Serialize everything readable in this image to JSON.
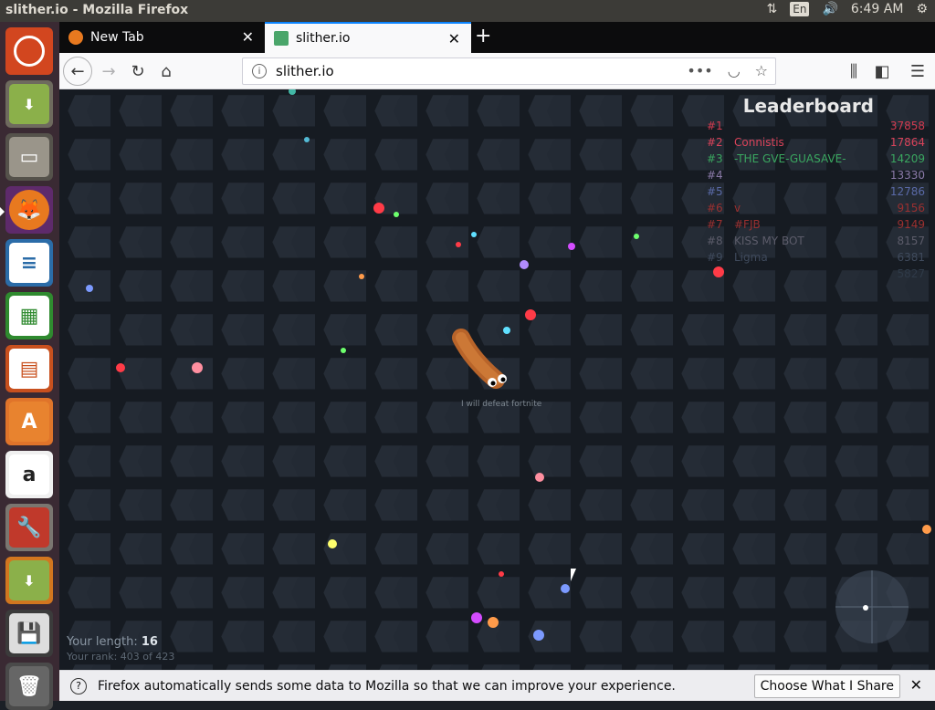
{
  "os_panel": {
    "window_title": "slither.io - Mozilla Firefox",
    "keyboard_layout": "En",
    "clock": "6:49 AM"
  },
  "launcher": {
    "items": [
      "ubuntu-logo",
      "system-installer",
      "file-manager",
      "firefox",
      "libreoffice-writer",
      "libreoffice-calc",
      "libreoffice-impress",
      "ubuntu-software",
      "amazon",
      "system-settings",
      "system-installer-2",
      "floppy-save",
      "trash"
    ]
  },
  "browser": {
    "tabs": [
      {
        "label": "New Tab",
        "active": false
      },
      {
        "label": "slither.io",
        "active": true
      }
    ],
    "url": "slither.io",
    "notification": {
      "message": "Firefox automatically sends some data to Mozilla so that we can improve your experience.",
      "button_label": "Choose What I Share"
    }
  },
  "game": {
    "leaderboard_title": "Leaderboard",
    "leaderboard": [
      {
        "rank": "#1",
        "name": "",
        "score": "37858",
        "color": "#d23a4f"
      },
      {
        "rank": "#2",
        "name": "Connistis",
        "score": "17864",
        "color": "#d9435a"
      },
      {
        "rank": "#3",
        "name": "-THE GVE-GUASAVE-",
        "score": "14209",
        "color": "#3aa760"
      },
      {
        "rank": "#4",
        "name": "",
        "score": "13330",
        "color": "#8a7aa8"
      },
      {
        "rank": "#5",
        "name": "",
        "score": "12786",
        "color": "#5a6aa8"
      },
      {
        "rank": "#6",
        "name": "v",
        "score": "9156",
        "color": "#9b3030"
      },
      {
        "rank": "#7",
        "name": "#FJB",
        "score": "9149",
        "color": "#9b3030"
      },
      {
        "rank": "#8",
        "name": "KISS MY BOT",
        "score": "8157",
        "color": "#5c5c6a"
      },
      {
        "rank": "#9",
        "name": "Ligma",
        "score": "6381",
        "color": "#3f4a5c"
      },
      {
        "rank": "",
        "name": "",
        "score": "5827",
        "color": "#2f3a48"
      }
    ],
    "snake_nickname": "I will defeat fortnite",
    "length_label": "Your length: ",
    "length_value": "16",
    "rank_text": "Your rank: 403 of 423"
  }
}
